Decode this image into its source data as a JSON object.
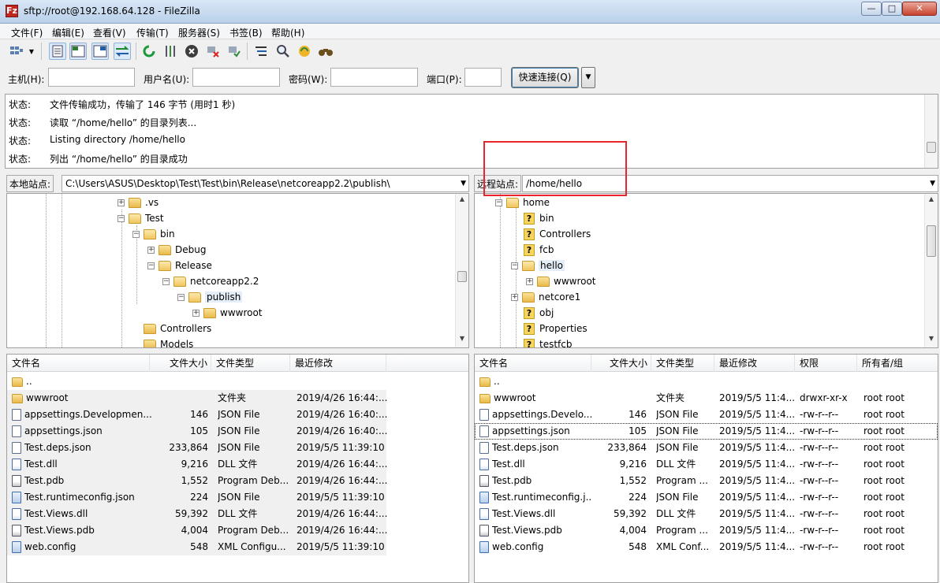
{
  "window": {
    "title": "sftp://root@192.168.64.128 - FileZilla",
    "app_icon": "Fz",
    "controls": {
      "minimize": "—",
      "maximize": "□",
      "close": "✕"
    }
  },
  "menubar": {
    "items": [
      "文件(F)",
      "编辑(E)",
      "查看(V)",
      "传输(T)",
      "服务器(S)",
      "书签(B)",
      "帮助(H)"
    ]
  },
  "toolbar": {
    "icons": [
      "site-manager-icon",
      "dropdown-arrow-icon",
      "toggle-log-icon",
      "toggle-local-tree-icon",
      "toggle-remote-tree-icon",
      "toggle-transfer-queue-icon",
      "refresh-icon",
      "process-queue-icon",
      "cancel-icon",
      "disconnect-icon",
      "reconnect-icon",
      "directory-filter-icon",
      "compare-icon",
      "sync-browse-icon",
      "find-files-icon"
    ]
  },
  "quickconnect": {
    "host_label": "主机(H):",
    "host_value": "",
    "user_label": "用户名(U):",
    "user_value": "",
    "password_label": "密码(W):",
    "password_value": "",
    "port_label": "端口(P):",
    "port_value": "",
    "button_label": "快速连接(Q)",
    "dropdown_glyph": "▼"
  },
  "log": [
    {
      "key": "状态:",
      "text": "文件传输成功，传输了 146 字节 (用时1 秒)"
    },
    {
      "key": "状态:",
      "text": "读取 “/home/hello” 的目录列表..."
    },
    {
      "key": "状态:",
      "text": "Listing directory /home/hello"
    },
    {
      "key": "状态:",
      "text": "列出 “/home/hello” 的目录成功"
    }
  ],
  "local": {
    "site_label": "本地站点:",
    "path": "C:\\Users\\ASUS\\Desktop\\Test\\Test\\bin\\Release\\netcoreapp2.2\\publish\\",
    "tree": [
      ".vs",
      "Test",
      "bin",
      "Debug",
      "Release",
      "netcoreapp2.2",
      "publish",
      "wwwroot",
      "Controllers",
      "Models"
    ],
    "columns": [
      "文件名",
      "文件大小",
      "文件类型",
      "最近修改"
    ],
    "files": [
      {
        "name": "..",
        "size": "",
        "type": "",
        "modified": ""
      },
      {
        "name": "wwwroot",
        "size": "",
        "type": "文件夹",
        "modified": "2019/4/26 16:44:..."
      },
      {
        "name": "appsettings.Developmen...",
        "size": "146",
        "type": "JSON File",
        "modified": "2019/4/26 16:40:..."
      },
      {
        "name": "appsettings.json",
        "size": "105",
        "type": "JSON File",
        "modified": "2019/4/26 16:40:..."
      },
      {
        "name": "Test.deps.json",
        "size": "233,864",
        "type": "JSON File",
        "modified": "2019/5/5 11:39:10"
      },
      {
        "name": "Test.dll",
        "size": "9,216",
        "type": "DLL 文件",
        "modified": "2019/4/26 16:44:..."
      },
      {
        "name": "Test.pdb",
        "size": "1,552",
        "type": "Program Deb...",
        "modified": "2019/4/26 16:44:..."
      },
      {
        "name": "Test.runtimeconfig.json",
        "size": "224",
        "type": "JSON File",
        "modified": "2019/5/5 11:39:10"
      },
      {
        "name": "Test.Views.dll",
        "size": "59,392",
        "type": "DLL 文件",
        "modified": "2019/4/26 16:44:..."
      },
      {
        "name": "Test.Views.pdb",
        "size": "4,004",
        "type": "Program Deb...",
        "modified": "2019/4/26 16:44:..."
      },
      {
        "name": "web.config",
        "size": "548",
        "type": "XML Configu...",
        "modified": "2019/5/5 11:39:10"
      }
    ]
  },
  "remote": {
    "site_label": "远程站点:",
    "path": "/home/hello",
    "tree": [
      "home",
      "bin",
      "Controllers",
      "fcb",
      "hello",
      "wwwroot",
      "netcore1",
      "obj",
      "Properties",
      "testfcb"
    ],
    "tree_unknown_glyph": "?",
    "columns": [
      "文件名",
      "文件大小",
      "文件类型",
      "最近修改",
      "权限",
      "所有者/组"
    ],
    "files": [
      {
        "name": "..",
        "size": "",
        "type": "",
        "modified": "",
        "perm": "",
        "owner": ""
      },
      {
        "name": "wwwroot",
        "size": "",
        "type": "文件夹",
        "modified": "2019/5/5 11:4...",
        "perm": "drwxr-xr-x",
        "owner": "root root"
      },
      {
        "name": "appsettings.Develo...",
        "size": "146",
        "type": "JSON File",
        "modified": "2019/5/5 11:4...",
        "perm": "-rw-r--r--",
        "owner": "root root"
      },
      {
        "name": "appsettings.json",
        "size": "105",
        "type": "JSON File",
        "modified": "2019/5/5 11:4...",
        "perm": "-rw-r--r--",
        "owner": "root root"
      },
      {
        "name": "Test.deps.json",
        "size": "233,864",
        "type": "JSON File",
        "modified": "2019/5/5 11:4...",
        "perm": "-rw-r--r--",
        "owner": "root root"
      },
      {
        "name": "Test.dll",
        "size": "9,216",
        "type": "DLL 文件",
        "modified": "2019/5/5 11:4...",
        "perm": "-rw-r--r--",
        "owner": "root root"
      },
      {
        "name": "Test.pdb",
        "size": "1,552",
        "type": "Program ...",
        "modified": "2019/5/5 11:4...",
        "perm": "-rw-r--r--",
        "owner": "root root"
      },
      {
        "name": "Test.runtimeconfig.j...",
        "size": "224",
        "type": "JSON File",
        "modified": "2019/5/5 11:4...",
        "perm": "-rw-r--r--",
        "owner": "root root"
      },
      {
        "name": "Test.Views.dll",
        "size": "59,392",
        "type": "DLL 文件",
        "modified": "2019/5/5 11:4...",
        "perm": "-rw-r--r--",
        "owner": "root root"
      },
      {
        "name": "Test.Views.pdb",
        "size": "4,004",
        "type": "Program ...",
        "modified": "2019/5/5 11:4...",
        "perm": "-rw-r--r--",
        "owner": "root root"
      },
      {
        "name": "web.config",
        "size": "548",
        "type": "XML Conf...",
        "modified": "2019/5/5 11:4...",
        "perm": "-rw-r--r--",
        "owner": "root root"
      }
    ]
  },
  "colors": {
    "highlight_box": "#e8252b",
    "selection": "#e5eef8"
  }
}
